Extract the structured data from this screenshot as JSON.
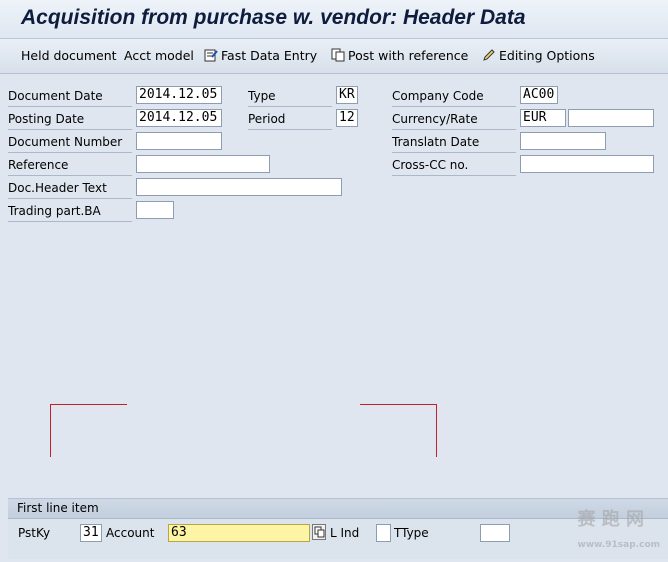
{
  "title": "Acquisition from purchase w. vendor: Header Data",
  "toolbar": {
    "held_document": "Held document",
    "acct_model": "Acct model",
    "fast_data_entry": "Fast Data Entry",
    "post_with_reference": "Post with reference",
    "editing_options": "Editing Options"
  },
  "form": {
    "document_date": {
      "label": "Document Date",
      "value": "2014.12.05"
    },
    "posting_date": {
      "label": "Posting Date",
      "value": "2014.12.05"
    },
    "document_number": {
      "label": "Document Number",
      "value": ""
    },
    "reference": {
      "label": "Reference",
      "value": ""
    },
    "doc_header_text": {
      "label": "Doc.Header Text",
      "value": ""
    },
    "trading_part_ba": {
      "label": "Trading part.BA",
      "value": ""
    },
    "type": {
      "label": "Type",
      "value": "KR"
    },
    "period": {
      "label": "Period",
      "value": "12"
    },
    "company_code": {
      "label": "Company Code",
      "value": "AC00"
    },
    "currency_rate": {
      "label": "Currency/Rate",
      "value": "EUR",
      "rate": ""
    },
    "translatn_date": {
      "label": "Translatn Date",
      "value": ""
    },
    "cross_cc_no": {
      "label": "Cross-CC no.",
      "value": ""
    }
  },
  "first_line_item": {
    "title": "First line item",
    "pstky_label": "PstKy",
    "pstky_value": "31",
    "account_label": "Account",
    "account_value": "63",
    "sgl_ind_label": "L Ind",
    "sgl_ind_value": "",
    "ttype_label": "TType",
    "ttype_value": ""
  },
  "watermark": "赛 跑 网",
  "watermark_url": "www.91sap.com",
  "colors": {
    "bracket": "#c0202a",
    "focused_field": "#fdf4a6"
  }
}
